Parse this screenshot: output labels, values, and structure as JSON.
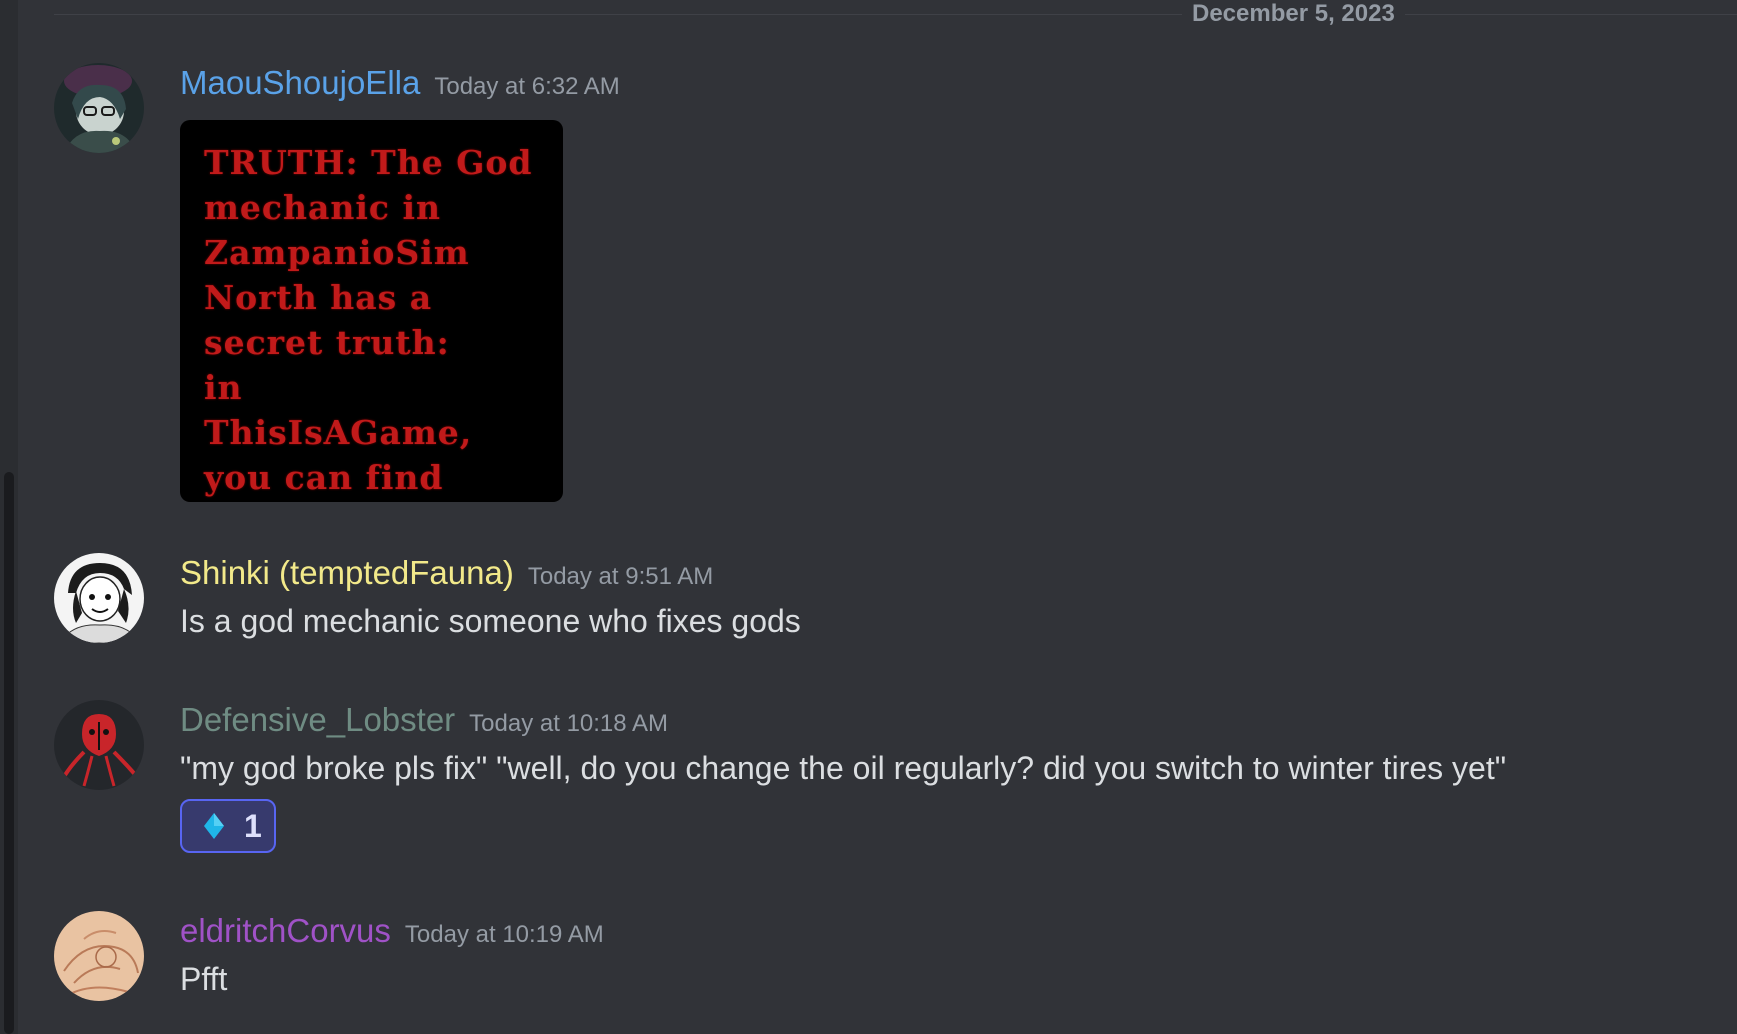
{
  "date_divider": "December 5, 2023",
  "messages": [
    {
      "username": "MaouShoujoElla",
      "username_color": "#5aa2e8",
      "timestamp": "Today at 6:32 AM",
      "attachment_text": "TRUTH: The God\nmechanic in\nZampanioSim\nNorth has a\nsecret truth:\nin\nThisIsAGame,\nyou can find",
      "avatar_icon": "avatar-icon"
    },
    {
      "username": "Shinki (temptedFauna)",
      "username_color": "#f2e98a",
      "timestamp": "Today at 9:51 AM",
      "text": "Is a god mechanic someone who fixes gods",
      "avatar_icon": "avatar-icon"
    },
    {
      "username": "Defensive_Lobster",
      "username_color": "#6f8c83",
      "timestamp": "Today at 10:18 AM",
      "text": "\"my god broke pls fix\" \"well, do you change the oil regularly? did you switch to winter tires yet\"",
      "avatar_icon": "avatar-icon",
      "reaction": {
        "emoji_icon": "blue-diamond-icon",
        "count": "1"
      }
    },
    {
      "username": "eldritchCorvus",
      "username_color": "#a052c7",
      "timestamp": "Today at 10:19 AM",
      "text": "Pfft",
      "avatar_icon": "avatar-icon"
    }
  ]
}
